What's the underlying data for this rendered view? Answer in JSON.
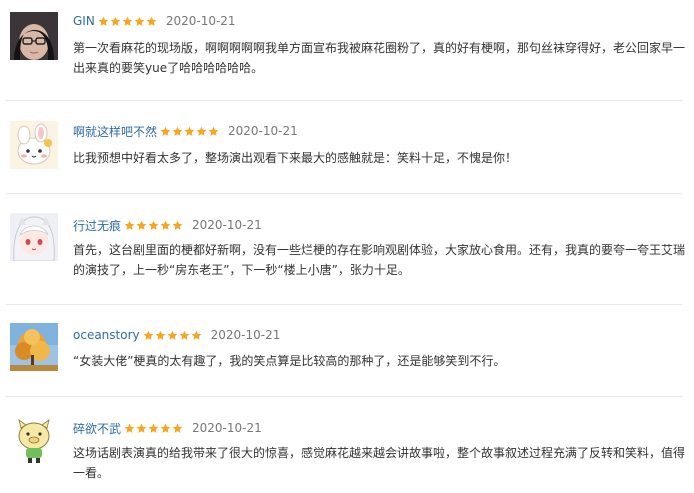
{
  "reviews": [
    {
      "user": "GIN",
      "rating": 5,
      "date": "2020-10-21",
      "avatar": "dark-hair-glasses-avatar",
      "text": "第一次看麻花的现场版，啊啊啊啊啊我单方面宣布我被麻花圈粉了，真的好有梗啊，那句丝袜穿得好，老公回家早一出来真的要笑yue了哈哈哈哈哈哈。"
    },
    {
      "user": "啊就这样吧不然",
      "rating": 5,
      "date": "2020-10-21",
      "avatar": "cartoon-rabbit-avatar",
      "text": "比我预想中好看太多了，整场演出观看下来最大的感触就是：笑料十足，不愧是你！"
    },
    {
      "user": "行过无痕",
      "rating": 5,
      "date": "2020-10-21",
      "avatar": "anime-girl-avatar",
      "text": "首先，这台剧里面的梗都好新啊，没有一些烂梗的存在影响观剧体验，大家放心食用。还有，我真的要夸一夸王艾瑞的演技了，上一秒“房东老王”，下一秒“楼上小唐”，张力十足。"
    },
    {
      "user": "oceanstory",
      "rating": 5,
      "date": "2020-10-21",
      "avatar": "autumn-tree-avatar",
      "text": "“女装大佬”梗真的太有趣了，我的笑点算是比较高的那种了，还是能够笑到不行。"
    },
    {
      "user": "碎欲不武",
      "rating": 5,
      "date": "2020-10-21",
      "avatar": "cartoon-pig-avatar",
      "text": "这场话剧表演真的给我带来了很大的惊喜，感觉麻花越来越会讲故事啦，整个故事叙述过程充满了反转和笑料，值得一看。"
    }
  ],
  "colors": {
    "username": "#2e6da4",
    "star": "#f5a623",
    "date": "#777777",
    "text": "#333333",
    "divider": "#e8e8e8"
  }
}
